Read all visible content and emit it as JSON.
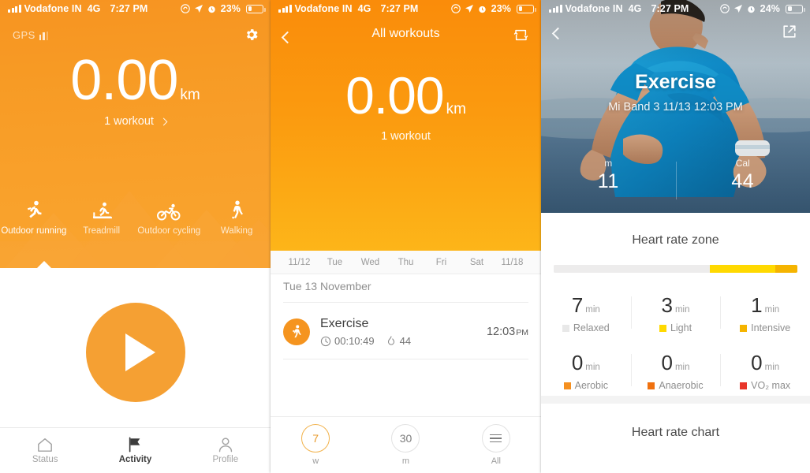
{
  "status_bar": {
    "carrier": "Vodafone IN",
    "network": "4G",
    "time": "7:27 PM",
    "battery_1": "23%",
    "battery_2": "23%",
    "battery_3": "24%",
    "icons": [
      "signal-bars-icon",
      "rotation-lock-icon",
      "location-arrow-icon",
      "alarm-clock-icon",
      "battery-icon"
    ]
  },
  "panel1": {
    "gps_label": "GPS",
    "settings_icon": "gear-icon",
    "distance_value": "0.00",
    "distance_unit": "km",
    "workout_count": "1 workout",
    "sports": [
      {
        "label": "Outdoor running",
        "icon": "running-icon",
        "active": true
      },
      {
        "label": "Treadmill",
        "icon": "treadmill-icon",
        "active": false
      },
      {
        "label": "Outdoor cycling",
        "icon": "cycling-icon",
        "active": false
      },
      {
        "label": "Walking",
        "icon": "walking-icon",
        "active": false
      }
    ],
    "start_button": "play-button",
    "tabs": [
      {
        "label": "Status",
        "icon": "home-icon",
        "active": false
      },
      {
        "label": "Activity",
        "icon": "flag-icon",
        "active": true
      },
      {
        "label": "Profile",
        "icon": "person-icon",
        "active": false
      }
    ],
    "accent": "#f59a23"
  },
  "panel2": {
    "back_icon": "chevron-left-icon",
    "title": "All workouts",
    "sync_icon": "sync-icon",
    "distance_value": "0.00",
    "distance_unit": "km",
    "workout_count": "1 workout",
    "day_strip": [
      "11/12",
      "Tue",
      "Wed",
      "Thu",
      "Fri",
      "Sat",
      "11/18"
    ],
    "date_header": "Tue 13 November",
    "workouts": [
      {
        "icon": "exercise-icon",
        "title": "Exercise",
        "duration": "00:10:49",
        "duration_icon": "clock-icon",
        "calories": "44",
        "calories_icon": "flame-icon",
        "time": "12:03",
        "time_meridiem": "PM"
      }
    ],
    "filters": [
      {
        "value": "7",
        "label": "w",
        "active": true
      },
      {
        "value": "30",
        "label": "m",
        "active": false
      },
      {
        "value": "",
        "label": "All",
        "icon": "hamburger-icon",
        "active": false
      }
    ],
    "accent": "#fa8c0a"
  },
  "panel3": {
    "back_icon": "chevron-left-icon",
    "share_icon": "share-icon",
    "title": "Exercise",
    "subtitle": "Mi Band 3 11/13 12:03 PM",
    "hero_stats": [
      {
        "label": "m",
        "value": "11"
      },
      {
        "label": "Cal",
        "value": "44"
      }
    ],
    "heart_rate_zone_title": "Heart rate zone",
    "heart_rate_chart_title": "Heart rate chart",
    "zones": [
      {
        "value": "7",
        "unit": "min",
        "label": "Relaxed",
        "color": "#e8e8e8",
        "bar_pct": 64
      },
      {
        "value": "3",
        "unit": "min",
        "label": "Light",
        "color": "#ffd900",
        "bar_pct": 27
      },
      {
        "value": "1",
        "unit": "min",
        "label": "Intensive",
        "color": "#f5b400",
        "bar_pct": 9
      },
      {
        "value": "0",
        "unit": "min",
        "label": "Aerobic",
        "color": "#f59020",
        "bar_pct": 0
      },
      {
        "value": "0",
        "unit": "min",
        "label": "Anaerobic",
        "color": "#f0710f",
        "bar_pct": 0
      },
      {
        "value": "0",
        "unit": "min",
        "label": "VO₂ max",
        "color": "#e8352a",
        "bar_pct": 0
      }
    ]
  }
}
